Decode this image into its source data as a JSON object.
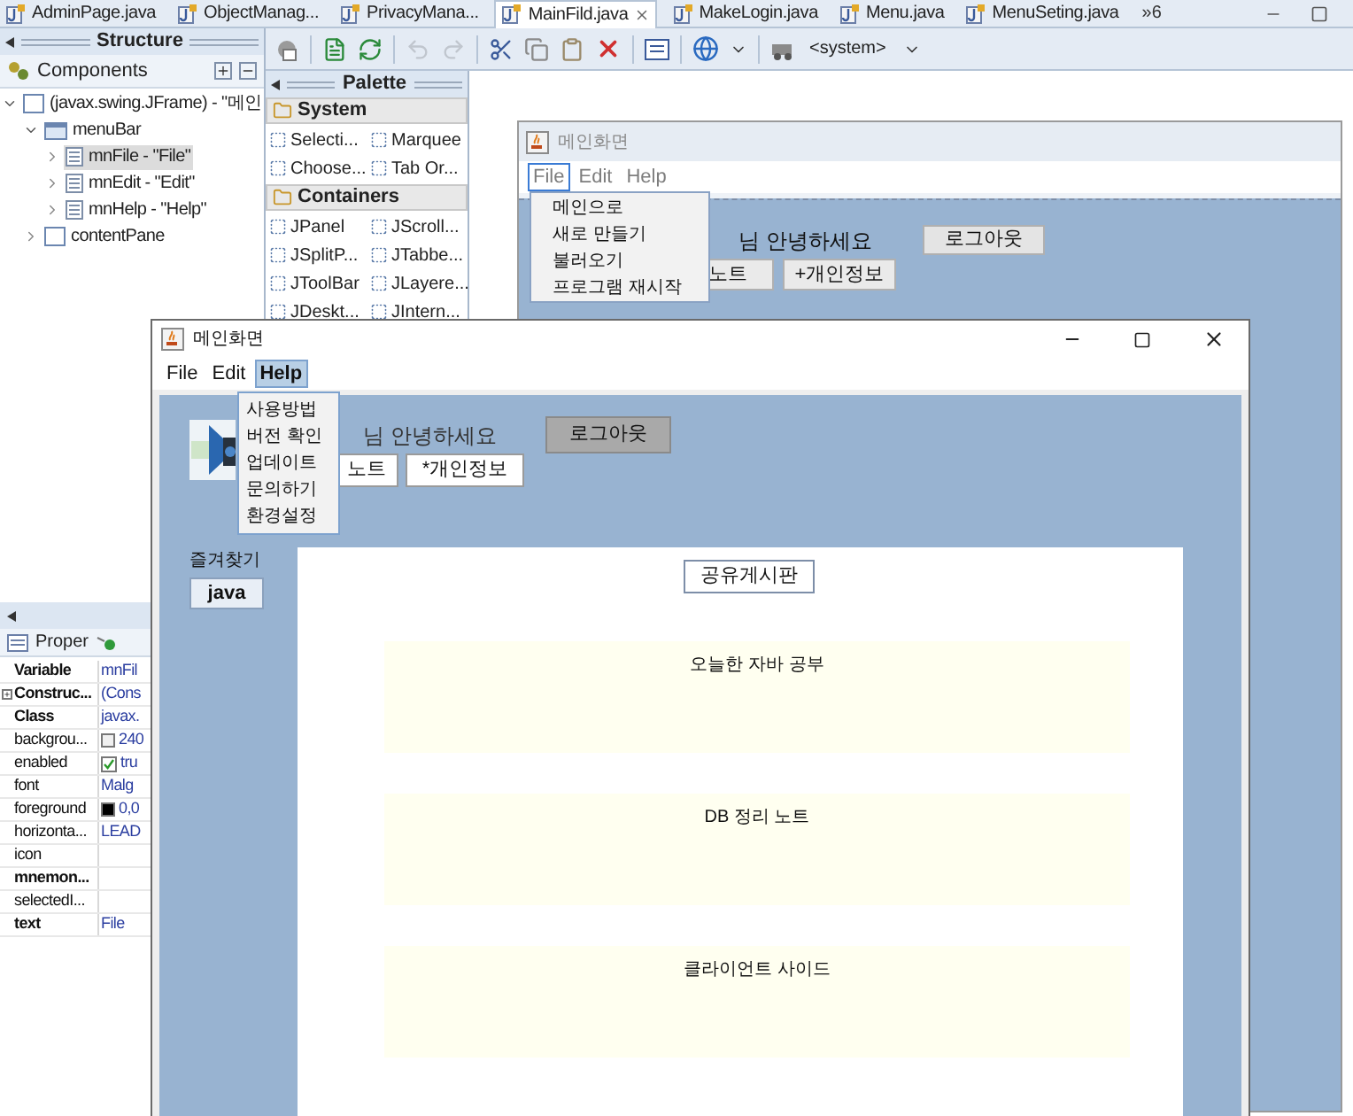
{
  "editor_tabs": [
    {
      "label": "AdminPage.java",
      "selected": false,
      "closable": false
    },
    {
      "label": "ObjectManag...",
      "selected": false,
      "closable": false
    },
    {
      "label": "PrivacyMana...",
      "selected": false,
      "closable": false
    },
    {
      "label": "MainFild.java",
      "selected": true,
      "closable": true
    },
    {
      "label": "MakeLogin.java",
      "selected": false,
      "closable": false
    },
    {
      "label": "Menu.java",
      "selected": false,
      "closable": false
    },
    {
      "label": "MenuSeting.java",
      "selected": false,
      "closable": false
    }
  ],
  "tab_overflow": "»6",
  "structure": {
    "title": "Structure",
    "components_label": "Components",
    "tree": [
      {
        "label": "(javax.swing.JFrame) - \"메인",
        "kind": "frame",
        "expanded": true,
        "selected": false,
        "children": [
          {
            "label": "menuBar",
            "kind": "menubar",
            "expanded": true,
            "selected": false,
            "children": [
              {
                "label": "mnFile - \"File\"",
                "kind": "menu",
                "expanded": false,
                "selected": true
              },
              {
                "label": "mnEdit - \"Edit\"",
                "kind": "menu",
                "expanded": false,
                "selected": false
              },
              {
                "label": "mnHelp - \"Help\"",
                "kind": "menu",
                "expanded": false,
                "selected": false
              }
            ]
          },
          {
            "label": "contentPane",
            "kind": "panel",
            "expanded": false,
            "selected": false
          }
        ]
      }
    ]
  },
  "toolbar": {
    "system_label": "<system>"
  },
  "palette": {
    "title": "Palette",
    "groups": [
      {
        "name": "System",
        "items": [
          "Selecti...",
          "Marquee",
          "Choose...",
          "Tab Or..."
        ]
      },
      {
        "name": "Containers",
        "items": [
          "JPanel",
          "JScroll...",
          "JSplitP...",
          "JTabbe...",
          "JToolBar",
          "JLayere...",
          "JDeskt...",
          "JIntern..."
        ]
      }
    ]
  },
  "properties": {
    "title": "Proper",
    "rows": [
      {
        "name": "Variable",
        "value": "mnFil",
        "bold": true,
        "kind": "text"
      },
      {
        "name": "Construc...",
        "value": "(Cons",
        "bold": true,
        "kind": "group"
      },
      {
        "name": "Class",
        "value": "javax.",
        "bold": true,
        "kind": "text"
      },
      {
        "name": "backgrou...",
        "value": "240",
        "bold": false,
        "kind": "color",
        "color": "#f0f0f0"
      },
      {
        "name": "enabled",
        "value": "tru",
        "bold": false,
        "kind": "checkbox",
        "checked": true
      },
      {
        "name": "font",
        "value": "Malg",
        "bold": false,
        "kind": "text"
      },
      {
        "name": "foreground",
        "value": "0,0",
        "bold": false,
        "kind": "color",
        "color": "#000000"
      },
      {
        "name": "horizonta...",
        "value": "LEAD",
        "bold": false,
        "kind": "text"
      },
      {
        "name": "icon",
        "bold": false,
        "kind": "text"
      },
      {
        "name": "mnemon...",
        "bold": true,
        "kind": "text"
      },
      {
        "name": "selectedI...",
        "bold": false,
        "kind": "text"
      },
      {
        "name": "text",
        "value": "File",
        "bold": true,
        "kind": "text"
      }
    ]
  },
  "designer_frame": {
    "title": "메인화면",
    "menus": [
      {
        "label": "File",
        "selected": true
      },
      {
        "label": "Edit",
        "selected": false
      },
      {
        "label": "Help",
        "selected": false
      }
    ],
    "open_menu": [
      "메인으로",
      "새로 만들기",
      "불러오기",
      "프로그램 재시작"
    ],
    "greeting": "님 안녕하세요",
    "logout": "로그아웃",
    "buttons": [
      "노트",
      "+개인정보"
    ]
  },
  "window": {
    "title": "메인화면",
    "menus": [
      {
        "label": "File",
        "selected": false
      },
      {
        "label": "Edit",
        "selected": false
      },
      {
        "label": "Help",
        "selected": true
      }
    ],
    "open_menu": [
      "사용방법",
      "버전 확인",
      "업데이트",
      "문의하기",
      "환경설정"
    ],
    "greeting": "님 안녕하세요",
    "logout": "로그아웃",
    "buttons": [
      "노트",
      "*개인정보"
    ],
    "favorites_label": "즐겨찾기",
    "favorites": [
      "java"
    ],
    "board_button": "공유게시판",
    "boards": [
      "오늘한 자바 공부",
      "DB 정리 노트",
      "클라이언트 사이드"
    ]
  }
}
